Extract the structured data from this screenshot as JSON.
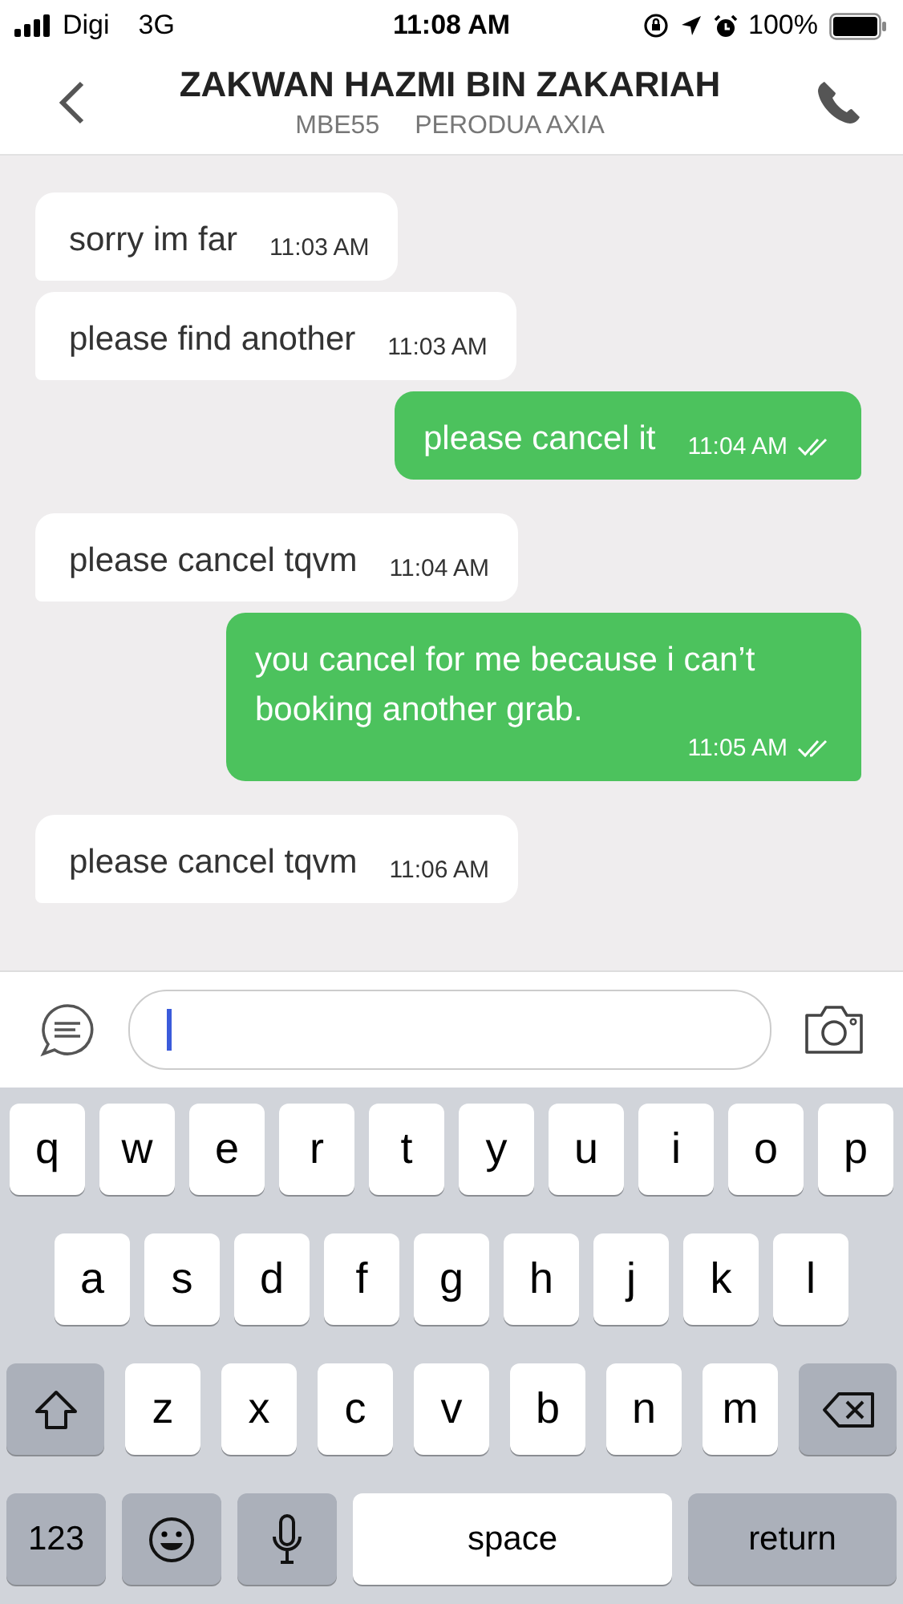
{
  "status_bar": {
    "carrier": "Digi",
    "network": "3G",
    "time": "11:08 AM",
    "battery": "100%"
  },
  "header": {
    "title": "ZAKWAN HAZMI BIN ZAKARIAH",
    "plate": "MBE55",
    "vehicle": "PERODUA AXIA"
  },
  "messages": [
    {
      "kind": "incoming",
      "text": "sorry im far",
      "time": "11:03 AM"
    },
    {
      "kind": "incoming",
      "text": "please find another",
      "time": "11:03 AM"
    },
    {
      "kind": "outgoing",
      "text": "please cancel it",
      "time": "11:04 AM",
      "read": true
    },
    {
      "kind": "incoming",
      "text": "please cancel tqvm",
      "time": "11:04 AM"
    },
    {
      "kind": "outgoing",
      "text": "you cancel for me because i can’t booking another grab.",
      "time": "11:05 AM",
      "read": true
    },
    {
      "kind": "incoming",
      "text": "please cancel tqvm",
      "time": "11:06 AM"
    }
  ],
  "keyboard": {
    "rows": [
      {
        "keys": [
          {
            "kind": "letter",
            "label": "q"
          },
          {
            "kind": "letter",
            "label": "w"
          },
          {
            "kind": "letter",
            "label": "e"
          },
          {
            "kind": "letter",
            "label": "r"
          },
          {
            "kind": "letter",
            "label": "t"
          },
          {
            "kind": "letter",
            "label": "y"
          },
          {
            "kind": "letter",
            "label": "u"
          },
          {
            "kind": "letter",
            "label": "i"
          },
          {
            "kind": "letter",
            "label": "o"
          },
          {
            "kind": "letter",
            "label": "p"
          }
        ]
      },
      {
        "keys": [
          {
            "kind": "letter",
            "label": "a"
          },
          {
            "kind": "letter",
            "label": "s"
          },
          {
            "kind": "letter",
            "label": "d"
          },
          {
            "kind": "letter",
            "label": "f"
          },
          {
            "kind": "letter",
            "label": "g"
          },
          {
            "kind": "letter",
            "label": "h"
          },
          {
            "kind": "letter",
            "label": "j"
          },
          {
            "kind": "letter",
            "label": "k"
          },
          {
            "kind": "letter",
            "label": "l"
          }
        ]
      },
      {
        "keys": [
          {
            "kind": "shift"
          },
          {
            "kind": "letter",
            "label": "z"
          },
          {
            "kind": "letter",
            "label": "x"
          },
          {
            "kind": "letter",
            "label": "c"
          },
          {
            "kind": "letter",
            "label": "v"
          },
          {
            "kind": "letter",
            "label": "b"
          },
          {
            "kind": "letter",
            "label": "n"
          },
          {
            "kind": "letter",
            "label": "m"
          },
          {
            "kind": "delete"
          }
        ]
      },
      {
        "keys": [
          {
            "kind": "function",
            "label": "123"
          },
          {
            "kind": "emoji"
          },
          {
            "kind": "mic"
          },
          {
            "kind": "space",
            "label": "space"
          },
          {
            "kind": "function",
            "label": "return"
          }
        ]
      }
    ]
  }
}
